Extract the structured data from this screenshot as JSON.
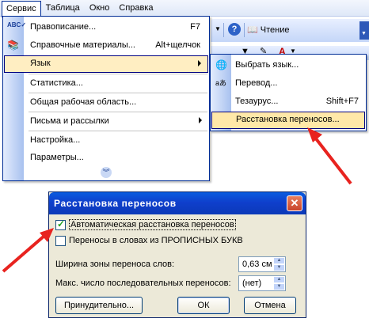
{
  "menubar": {
    "items": [
      "Сервис",
      "Таблица",
      "Окно",
      "Справка"
    ]
  },
  "toolbar": {
    "reading_label": "Чтение"
  },
  "service_menu": {
    "items": [
      {
        "label": "Правописание...",
        "shortcut": "F7",
        "icon": "spelling-icon"
      },
      {
        "label": "Справочные материалы...",
        "shortcut": "Alt+щелчок",
        "icon": "research-icon"
      },
      {
        "label": "Язык",
        "submenu": true
      },
      {
        "label": "Статистика..."
      },
      {
        "label": "Общая рабочая область..."
      },
      {
        "label": "Письма и рассылки",
        "submenu": true
      },
      {
        "label": "Настройка..."
      },
      {
        "label": "Параметры..."
      }
    ],
    "expand_icon": "chevron-double-down-icon"
  },
  "language_submenu": {
    "items": [
      {
        "label": "Выбрать язык...",
        "icon": "globe-icon"
      },
      {
        "label": "Перевод...",
        "icon": "translate-icon"
      },
      {
        "label": "Тезаурус...",
        "shortcut": "Shift+F7"
      },
      {
        "label": "Расстановка переносов..."
      }
    ]
  },
  "dialog": {
    "title": "Расстановка переносов",
    "auto_hyphenation": {
      "label": "Автоматическая расстановка переносов",
      "checked": true
    },
    "caps_hyphenation": {
      "label": "Переносы в словах из ПРОПИСНЫХ БУКВ",
      "checked": false
    },
    "zone_width": {
      "label": "Ширина зоны переноса слов:",
      "value": "0,63 см"
    },
    "max_consecutive": {
      "label": "Макс. число последовательных переносов:",
      "value": "(нет)"
    },
    "buttons": {
      "manual": "Принудительно...",
      "ok": "ОК",
      "cancel": "Отмена"
    }
  },
  "colors": {
    "highlight": "#ffeec2",
    "titlebar": "#0b39b8",
    "arrow": "#e8231f"
  }
}
